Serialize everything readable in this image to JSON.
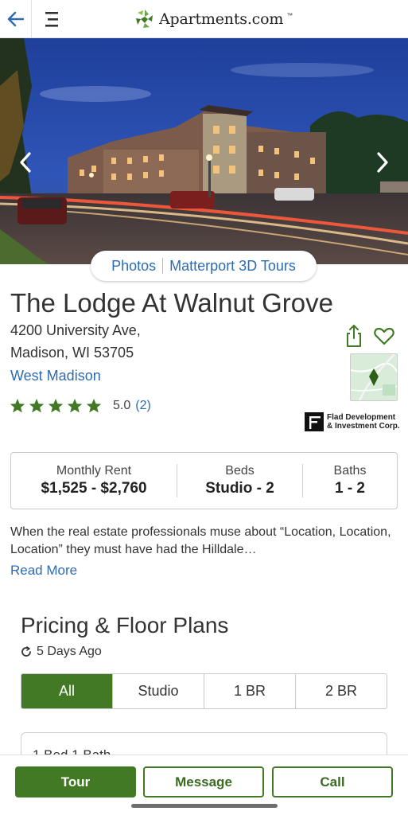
{
  "header": {
    "logo_text": "Apartments.com",
    "logo_tm": "™"
  },
  "hero": {
    "media_links": [
      "Photos",
      "Matterport 3D Tours"
    ]
  },
  "property": {
    "name": "The Lodge At Walnut Grove",
    "address_line1": "4200 University Ave,",
    "address_line2": "Madison, WI 53705",
    "neighborhood": "West Madison",
    "rating": "5.0",
    "review_count": "(2)",
    "stars": 5,
    "management": [
      "Flad Development",
      "& Investment Corp."
    ]
  },
  "summary": {
    "rent_label": "Monthly Rent",
    "rent_value": "$1,525 - $2,760",
    "beds_label": "Beds",
    "beds_value": "Studio - 2",
    "baths_label": "Baths",
    "baths_value": "1 - 2"
  },
  "description": {
    "text": "When the real estate professionals muse about “Location, Location, Location” they must have had the Hilldale…",
    "read_more": "Read More"
  },
  "pricing": {
    "title": "Pricing & Floor Plans",
    "updated": "5 Days Ago",
    "tabs": [
      "All",
      "Studio",
      "1 BR",
      "2 BR"
    ],
    "active_tab": "All",
    "first_card_title": "1 Bed 1 Bath"
  },
  "actions": {
    "tour": "Tour",
    "message": "Message",
    "call": "Call"
  },
  "colors": {
    "brand_green": "#427924",
    "link_blue": "#2f6bb0"
  }
}
